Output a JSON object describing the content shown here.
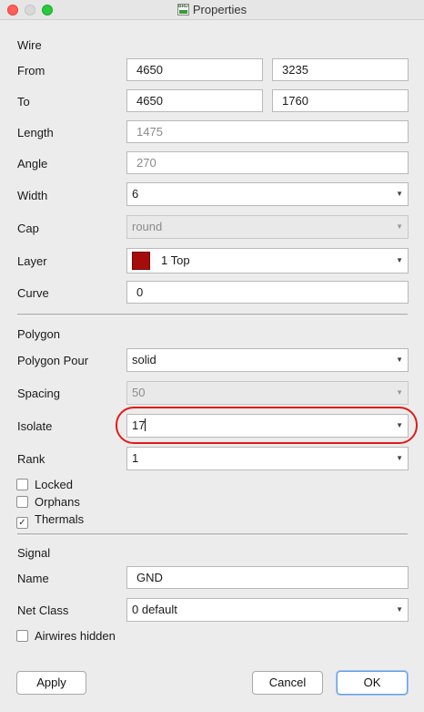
{
  "window": {
    "title": "Properties",
    "icon_text": "BRD"
  },
  "wire": {
    "section_label": "Wire",
    "from_label": "From",
    "from_x": "4650",
    "from_y": "3235",
    "to_label": "To",
    "to_x": "4650",
    "to_y": "1760",
    "length_label": "Length",
    "length_value": "1475",
    "angle_label": "Angle",
    "angle_value": "270",
    "width_label": "Width",
    "width_value": "6",
    "cap_label": "Cap",
    "cap_value": "round",
    "layer_label": "Layer",
    "layer_value": "1 Top",
    "layer_color": "#a50c0c",
    "curve_label": "Curve",
    "curve_value": "0"
  },
  "polygon": {
    "section_label": "Polygon",
    "pour_label": "Polygon Pour",
    "pour_value": "solid",
    "spacing_label": "Spacing",
    "spacing_value": "50",
    "isolate_label": "Isolate",
    "isolate_value": "17",
    "rank_label": "Rank",
    "rank_value": "1",
    "locked_label": "Locked",
    "locked": false,
    "orphans_label": "Orphans",
    "orphans": false,
    "thermals_label": "Thermals",
    "thermals": true
  },
  "signal": {
    "section_label": "Signal",
    "name_label": "Name",
    "name_value": "GND",
    "netclass_label": "Net Class",
    "netclass_value": "0 default",
    "airwires_label": "Airwires hidden",
    "airwires_hidden": false
  },
  "buttons": {
    "apply": "Apply",
    "cancel": "Cancel",
    "ok": "OK"
  },
  "icons": {
    "dropdown": "▼",
    "check": "✓"
  },
  "colors": {
    "highlight": "#e21b1b",
    "default_button_focus": "#6a9ce0"
  }
}
